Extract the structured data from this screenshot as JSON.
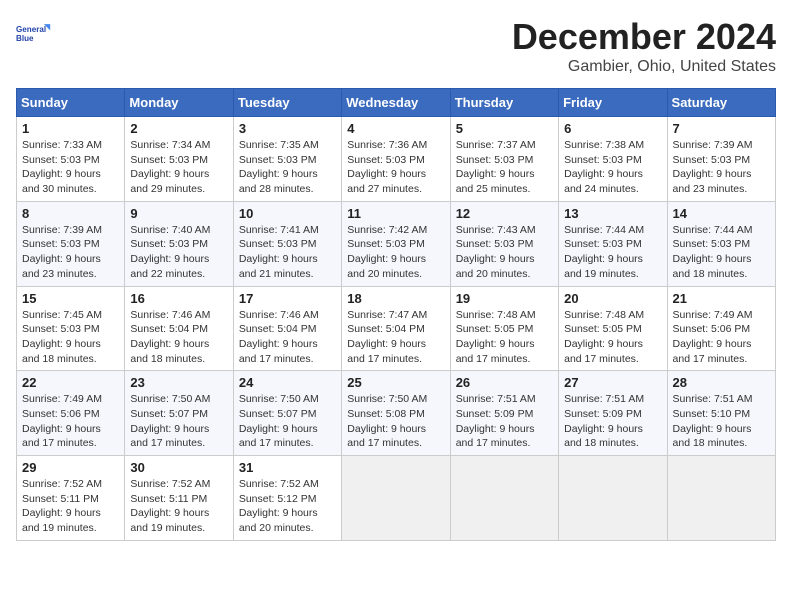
{
  "header": {
    "logo_line1": "General",
    "logo_line2": "Blue",
    "main_title": "December 2024",
    "subtitle": "Gambier, Ohio, United States"
  },
  "calendar": {
    "days_of_week": [
      "Sunday",
      "Monday",
      "Tuesday",
      "Wednesday",
      "Thursday",
      "Friday",
      "Saturday"
    ],
    "weeks": [
      [
        {
          "day": "",
          "info": ""
        },
        {
          "day": "2",
          "info": "Sunrise: 7:34 AM\nSunset: 5:03 PM\nDaylight: 9 hours\nand 29 minutes."
        },
        {
          "day": "3",
          "info": "Sunrise: 7:35 AM\nSunset: 5:03 PM\nDaylight: 9 hours\nand 28 minutes."
        },
        {
          "day": "4",
          "info": "Sunrise: 7:36 AM\nSunset: 5:03 PM\nDaylight: 9 hours\nand 27 minutes."
        },
        {
          "day": "5",
          "info": "Sunrise: 7:37 AM\nSunset: 5:03 PM\nDaylight: 9 hours\nand 25 minutes."
        },
        {
          "day": "6",
          "info": "Sunrise: 7:38 AM\nSunset: 5:03 PM\nDaylight: 9 hours\nand 24 minutes."
        },
        {
          "day": "7",
          "info": "Sunrise: 7:39 AM\nSunset: 5:03 PM\nDaylight: 9 hours\nand 23 minutes."
        }
      ],
      [
        {
          "day": "8",
          "info": "Sunrise: 7:39 AM\nSunset: 5:03 PM\nDaylight: 9 hours\nand 23 minutes."
        },
        {
          "day": "9",
          "info": "Sunrise: 7:40 AM\nSunset: 5:03 PM\nDaylight: 9 hours\nand 22 minutes."
        },
        {
          "day": "10",
          "info": "Sunrise: 7:41 AM\nSunset: 5:03 PM\nDaylight: 9 hours\nand 21 minutes."
        },
        {
          "day": "11",
          "info": "Sunrise: 7:42 AM\nSunset: 5:03 PM\nDaylight: 9 hours\nand 20 minutes."
        },
        {
          "day": "12",
          "info": "Sunrise: 7:43 AM\nSunset: 5:03 PM\nDaylight: 9 hours\nand 20 minutes."
        },
        {
          "day": "13",
          "info": "Sunrise: 7:44 AM\nSunset: 5:03 PM\nDaylight: 9 hours\nand 19 minutes."
        },
        {
          "day": "14",
          "info": "Sunrise: 7:44 AM\nSunset: 5:03 PM\nDaylight: 9 hours\nand 18 minutes."
        }
      ],
      [
        {
          "day": "15",
          "info": "Sunrise: 7:45 AM\nSunset: 5:03 PM\nDaylight: 9 hours\nand 18 minutes."
        },
        {
          "day": "16",
          "info": "Sunrise: 7:46 AM\nSunset: 5:04 PM\nDaylight: 9 hours\nand 18 minutes."
        },
        {
          "day": "17",
          "info": "Sunrise: 7:46 AM\nSunset: 5:04 PM\nDaylight: 9 hours\nand 17 minutes."
        },
        {
          "day": "18",
          "info": "Sunrise: 7:47 AM\nSunset: 5:04 PM\nDaylight: 9 hours\nand 17 minutes."
        },
        {
          "day": "19",
          "info": "Sunrise: 7:48 AM\nSunset: 5:05 PM\nDaylight: 9 hours\nand 17 minutes."
        },
        {
          "day": "20",
          "info": "Sunrise: 7:48 AM\nSunset: 5:05 PM\nDaylight: 9 hours\nand 17 minutes."
        },
        {
          "day": "21",
          "info": "Sunrise: 7:49 AM\nSunset: 5:06 PM\nDaylight: 9 hours\nand 17 minutes."
        }
      ],
      [
        {
          "day": "22",
          "info": "Sunrise: 7:49 AM\nSunset: 5:06 PM\nDaylight: 9 hours\nand 17 minutes."
        },
        {
          "day": "23",
          "info": "Sunrise: 7:50 AM\nSunset: 5:07 PM\nDaylight: 9 hours\nand 17 minutes."
        },
        {
          "day": "24",
          "info": "Sunrise: 7:50 AM\nSunset: 5:07 PM\nDaylight: 9 hours\nand 17 minutes."
        },
        {
          "day": "25",
          "info": "Sunrise: 7:50 AM\nSunset: 5:08 PM\nDaylight: 9 hours\nand 17 minutes."
        },
        {
          "day": "26",
          "info": "Sunrise: 7:51 AM\nSunset: 5:09 PM\nDaylight: 9 hours\nand 17 minutes."
        },
        {
          "day": "27",
          "info": "Sunrise: 7:51 AM\nSunset: 5:09 PM\nDaylight: 9 hours\nand 18 minutes."
        },
        {
          "day": "28",
          "info": "Sunrise: 7:51 AM\nSunset: 5:10 PM\nDaylight: 9 hours\nand 18 minutes."
        }
      ],
      [
        {
          "day": "29",
          "info": "Sunrise: 7:52 AM\nSunset: 5:11 PM\nDaylight: 9 hours\nand 19 minutes."
        },
        {
          "day": "30",
          "info": "Sunrise: 7:52 AM\nSunset: 5:11 PM\nDaylight: 9 hours\nand 19 minutes."
        },
        {
          "day": "31",
          "info": "Sunrise: 7:52 AM\nSunset: 5:12 PM\nDaylight: 9 hours\nand 20 minutes."
        },
        {
          "day": "",
          "info": ""
        },
        {
          "day": "",
          "info": ""
        },
        {
          "day": "",
          "info": ""
        },
        {
          "day": "",
          "info": ""
        }
      ]
    ],
    "week1_day1": {
      "day": "1",
      "info": "Sunrise: 7:33 AM\nSunset: 5:03 PM\nDaylight: 9 hours\nand 30 minutes."
    }
  }
}
